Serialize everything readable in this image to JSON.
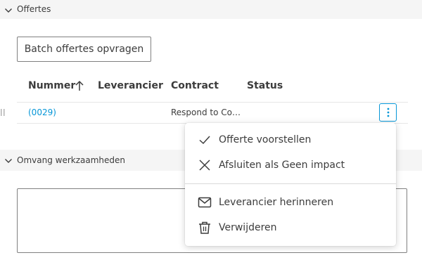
{
  "sections": {
    "offertes": {
      "title": "Offertes"
    },
    "omvang": {
      "title": "Omvang werkzaamheden"
    }
  },
  "batch_button": {
    "label": "Batch offertes opvragen"
  },
  "table": {
    "columns": {
      "nummer": "Nummer",
      "leverancier": "Leverancier",
      "contract": "Contract",
      "status": "Status"
    },
    "rows": [
      {
        "nummer": "(0029)",
        "leverancier": "",
        "contract": "Respond to Co…",
        "status": ""
      }
    ]
  },
  "menu": {
    "items": [
      {
        "label": "Offerte voorstellen",
        "icon": "check-icon"
      },
      {
        "label": "Afsluiten als Geen impact",
        "icon": "close-icon"
      },
      {
        "label": "Leverancier herinneren",
        "icon": "mail-icon"
      },
      {
        "label": "Verwijderen",
        "icon": "trash-icon"
      }
    ]
  },
  "colors": {
    "accent": "#0696d7",
    "section_bg": "#f5f5f5",
    "text": "#3c3c3c"
  }
}
